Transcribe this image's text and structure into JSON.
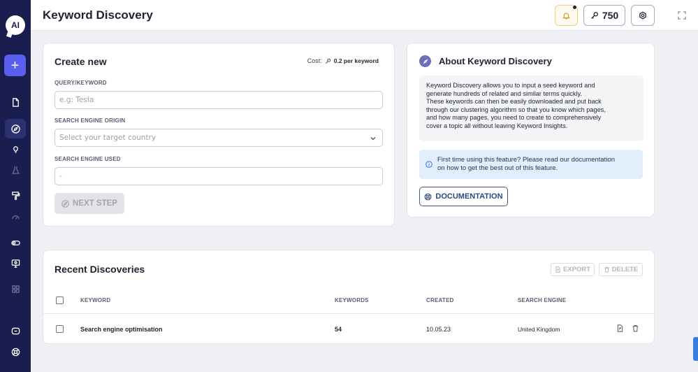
{
  "app": {
    "logo_text": "AI"
  },
  "sidebar": {
    "icons": [
      "document-icon",
      "compass-icon",
      "lightbulb-icon",
      "flask-icon",
      "paint-roller-icon",
      "gauge-icon",
      "toggle-icon",
      "monitor-icon",
      "grid-icon",
      "chat-icon",
      "help-icon"
    ]
  },
  "header": {
    "title": "Keyword Discovery",
    "credits": "750"
  },
  "create": {
    "title": "Create new",
    "cost_label": "Cost:",
    "cost_value": "0.2 per keyword",
    "query_label": "QUERY/KEYWORD",
    "query_placeholder": "e.g: Tesla",
    "origin_label": "SEARCH ENGINE ORIGIN",
    "origin_placeholder": "Select your target country",
    "used_label": "SEARCH ENGINE USED",
    "used_value": "-",
    "next_label": "NEXT STEP"
  },
  "about": {
    "title": "About Keyword Discovery",
    "lines": [
      "Keyword Discovery allows you to input a seed keyword and",
      "generate hundreds of related and similar terms quickly.",
      "These keywords can then be easily downloaded and put back",
      "through our clustering algorithm so that you know which pages,",
      "and how many pages, you need to create to comprehensively",
      "cover a topic all without leaving Keyword Insights."
    ],
    "info_line1": "First time using this feature? Please read our documentation",
    "info_line2": "on how to get the best out of this feature.",
    "doc_label": "DOCUMENTATION"
  },
  "recent": {
    "title": "Recent Discoveries",
    "export_label": "EXPORT",
    "delete_label": "DELETE",
    "columns": {
      "keyword": "KEYWORD",
      "keywords": "KEYWORDS",
      "created": "CREATED",
      "engine": "SEARCH ENGINE"
    },
    "rows": [
      {
        "keyword": "Search engine optimisation",
        "keywords": "54",
        "created": "10.05.23",
        "engine": "United Kingdom"
      }
    ]
  },
  "colors": {
    "sidebar": "#1a1e4e",
    "accent": "#5a5ff0",
    "doc_border": "#3c5a8a",
    "info_bg": "#e3eefc"
  }
}
